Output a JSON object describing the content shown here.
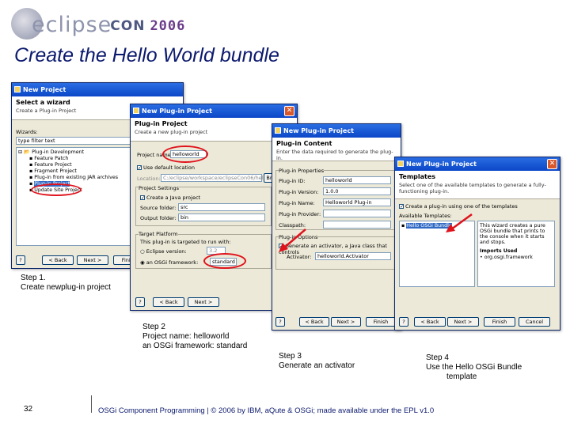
{
  "header": {
    "logo_eclipse": "eclipse",
    "logo_con": "CON",
    "logo_year": "2006"
  },
  "slide": {
    "title": "Create the Hello World bundle"
  },
  "dialog1": {
    "title": "New Project",
    "heading": "Select a wizard",
    "desc": "Create a Plug-in Project",
    "wizards_label": "Wizards:",
    "filter_value": "type filter text",
    "tree": [
      "Plug-in Development",
      "Feature Patch",
      "Feature Project",
      "Fragment Project",
      "Plug-in from existing JAR archives",
      "Plug-in Project",
      "Update Site Project"
    ],
    "back": "< Back",
    "next": "Next >",
    "finish": "Finish"
  },
  "dialog2": {
    "title": "New Plug-in Project",
    "heading": "Plug-in Project",
    "desc": "Create a new plug-in project",
    "project_name_label": "Project name:",
    "project_name_value": "helloworld",
    "use_default_location": "Use default location",
    "location_label": "Location:",
    "location_value": "C:/eclipse/workspace/eclipseCon06/hello",
    "browse": "Br",
    "project_settings": "Project Settings",
    "create_java": "Create a Java project",
    "source_folder_label": "Source folder:",
    "source_folder_value": "src",
    "output_folder_label": "Output folder:",
    "output_folder_value": "bin",
    "target_platform": "Target Platform",
    "target_desc": "This plug-in is targeted to run with:",
    "eclipse_version": "Eclipse version:",
    "eclipse_version_value": "3.2",
    "osgi_framework": "an OSGi framework:",
    "osgi_value": "standard",
    "back": "< Back",
    "next": "Next >"
  },
  "dialog3": {
    "title": "New Plug-in Project",
    "heading": "Plug-in Content",
    "desc": "Enter the data required to generate the plug-in.",
    "props_group": "Plug-in Properties",
    "id_label": "Plug-in ID:",
    "id_value": "helloworld",
    "version_label": "Plug-in Version:",
    "version_value": "1.0.0",
    "name_label": "Plug-in Name:",
    "name_value": "Helloworld Plug-in",
    "provider_label": "Plug-in Provider:",
    "provider_value": "",
    "classpath_label": "Classpath:",
    "classpath_value": "",
    "options_group": "Plug-in Options",
    "generate_activator": "Generate an activator, a Java class that controls",
    "activator_label": "Activator:",
    "activator_value": "helloworld.Activator",
    "back": "< Back",
    "next": "Next >",
    "finish": "Finish"
  },
  "dialog4": {
    "title": "New Plug-in Project",
    "heading": "Templates",
    "desc": "Select one of the available templates to generate a fully-functioning plug-in.",
    "create_using": "Create a plug-in using one of the templates",
    "available": "Available Templates:",
    "template_item": "Hello OSGi Bundle",
    "template_desc": "This wizard creates a pure OSGi bundle that prints to the console when it starts and stops.",
    "imports_label": "Imports Used",
    "imports_item": "org.osgi.framework",
    "back": "< Back",
    "next": "Next >",
    "finish": "Finish",
    "cancel": "Cancel"
  },
  "captions": {
    "step1_line1": "Step 1.",
    "step1_line2": "Create newplug-in project",
    "step2_line1": "Step 2",
    "step2_line2": "Project name: helloworld",
    "step2_line3": "an OSGi framework: standard",
    "step3_line1": "Step 3",
    "step3_line2": "Generate an activator",
    "step4_line1": "Step 4",
    "step4_line2": "Use the Hello OSGi Bundle",
    "step4_line3": "template"
  },
  "footer": {
    "page_number": "32",
    "text": "OSGi Component Programming | © 2006 by IBM, aQute & OSGi; made available under the EPL v1.0"
  },
  "colors": {
    "title_blue": "#0c1a6e",
    "highlight_red": "#e0121c",
    "titlebar_blue": "#0b47c7"
  }
}
